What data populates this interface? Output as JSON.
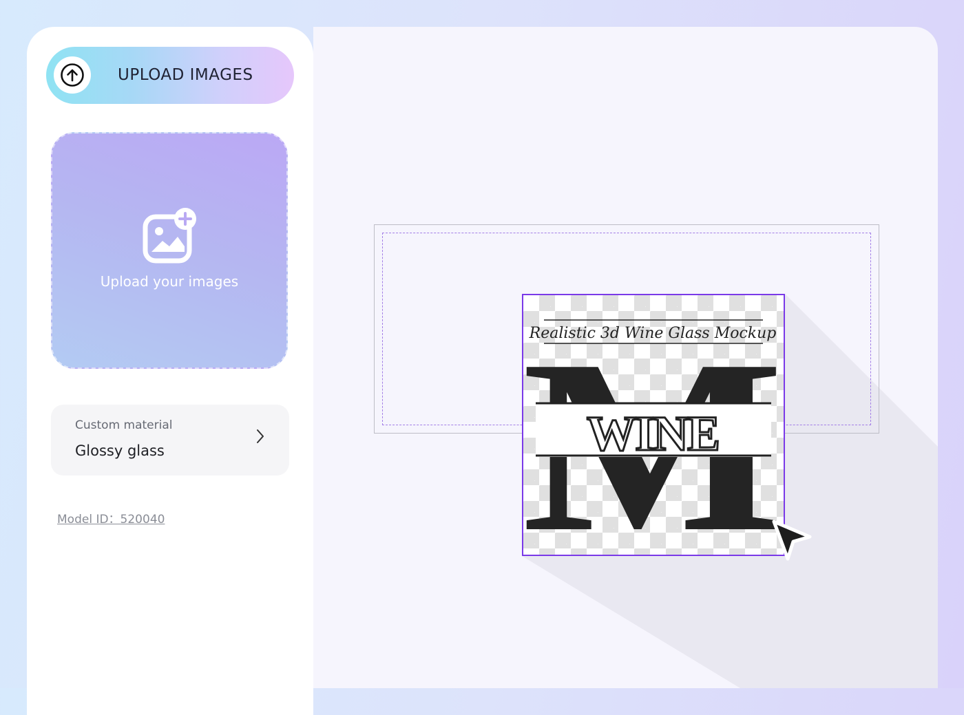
{
  "sidebar": {
    "upload_button_label": "UPLOAD IMAGES",
    "dropzone_text": "Upload your images",
    "material": {
      "caption": "Custom material",
      "value": "Glossy glass"
    },
    "model_id": "Model ID：520040"
  },
  "design": {
    "script_line": "Realistic 3d Wine Glass Mockup",
    "monogram_letter": "M",
    "word": "WINE"
  },
  "icons": {
    "upload": "upload-arrow-circle-icon",
    "add_image": "add-image-icon",
    "chevron": "chevron-right-icon",
    "cursor": "mouse-pointer-icon"
  },
  "colors": {
    "accent_purple": "#7a39e8",
    "safe_zone_dashed": "#a27de6"
  }
}
